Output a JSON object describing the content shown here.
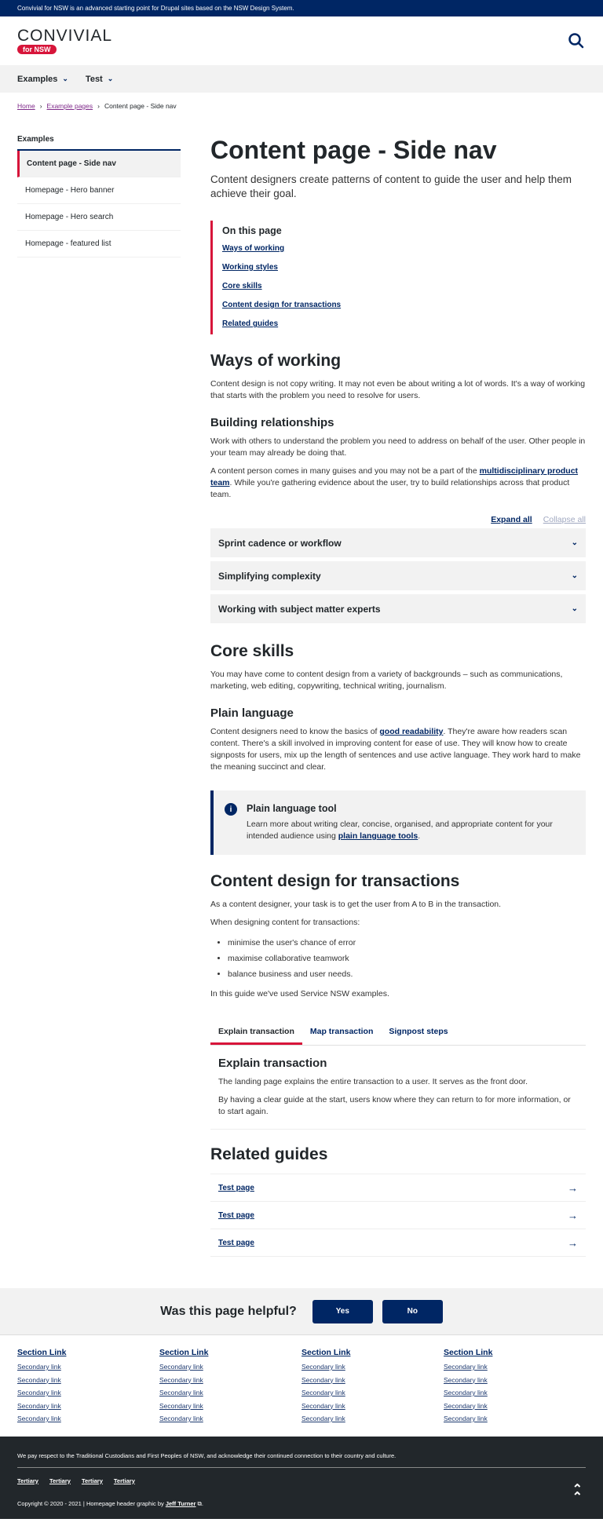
{
  "masthead": {
    "text": "Convivial for NSW is an advanced starting point for Drupal sites based on the NSW Design System."
  },
  "header": {
    "logo_word": "CONVIVIAL",
    "logo_pill": "for NSW",
    "search_icon": "search-icon"
  },
  "mainnav": {
    "items": [
      {
        "label": "Examples"
      },
      {
        "label": "Test"
      }
    ]
  },
  "breadcrumb": {
    "items": [
      {
        "label": "Home"
      },
      {
        "label": "Example pages"
      }
    ],
    "current": "Content page - Side nav"
  },
  "sidenav": {
    "title": "Examples",
    "items": [
      {
        "label": "Content page - Side nav",
        "active": true
      },
      {
        "label": "Homepage - Hero banner"
      },
      {
        "label": "Homepage - Hero search"
      },
      {
        "label": "Homepage - featured list"
      }
    ]
  },
  "page": {
    "title": "Content page - Side nav",
    "intro": "Content designers create patterns of content to guide the user and help them achieve their goal."
  },
  "on_this_page": {
    "title": "On this page",
    "links": [
      "Ways of working",
      "Working styles",
      "Core skills",
      "Content design for transactions",
      "Related guides"
    ]
  },
  "ways": {
    "title": "Ways of working",
    "p1": "Content design is not copy writing. It may not even be about writing a lot of words. It's a way of working that starts with the problem you need to resolve for users.",
    "sub": "Building relationships",
    "p2": "Work with others to understand the problem you need to address on behalf of the user. Other people in your team may already be doing that.",
    "p3_before": "A content person comes in many guises and you may not be a part of the ",
    "p3_link": "multidisciplinary product team",
    "p3_after": ". While you're gathering evidence about the user, try to build relationships across that product team."
  },
  "accordion": {
    "expand_all": "Expand all",
    "collapse_all": "Collapse all",
    "items": [
      "Sprint cadence or workflow",
      "Simplifying complexity",
      "Working with subject matter experts"
    ]
  },
  "core": {
    "title": "Core skills",
    "p1": "You may have come to content design from a variety of backgrounds – such as communications, marketing, web editing, copywriting, technical writing, journalism.",
    "sub": "Plain language",
    "p2_before": "Content designers need to know the basics of ",
    "p2_link": "good readability",
    "p2_after": ". They're aware how readers scan content. There's a skill involved in improving content for ease of use. They will know how to create signposts for users, mix up the length of sentences and use active language. They work hard to make the meaning succinct and clear."
  },
  "callout": {
    "title": "Plain language tool",
    "text_before": "Learn more about writing clear, concise, organised, and appropriate content for your intended audience using ",
    "link": "plain language tools",
    "text_after": "."
  },
  "transactions": {
    "title": "Content design for transactions",
    "p1": "As a content designer, your task is to get the user from A to B in the transaction.",
    "p2": "When designing content for transactions:",
    "bullets": [
      "minimise the user's chance of error",
      "maximise collaborative teamwork",
      "balance business and user needs."
    ],
    "p3": "In this guide we've used Service NSW examples."
  },
  "tabs": {
    "items": [
      {
        "label": "Explain transaction",
        "active": true
      },
      {
        "label": "Map transaction"
      },
      {
        "label": "Signpost steps"
      }
    ],
    "panel_title": "Explain transaction",
    "panel_p1": "The landing page explains the entire transaction to a user. It serves as the front door.",
    "panel_p2": "By having a clear guide at the start, users know where they can return to for more information, or to start again."
  },
  "related": {
    "title": "Related guides",
    "items": [
      "Test page",
      "Test page",
      "Test page"
    ]
  },
  "feedback": {
    "question": "Was this page helpful?",
    "yes": "Yes",
    "no": "No"
  },
  "footer": {
    "columns": [
      {
        "section": "Section Link",
        "links": [
          "Secondary link",
          "Secondary link",
          "Secondary link",
          "Secondary link",
          "Secondary link"
        ]
      },
      {
        "section": "Section Link",
        "links": [
          "Secondary link",
          "Secondary link",
          "Secondary link",
          "Secondary link",
          "Secondary link"
        ]
      },
      {
        "section": "Section Link",
        "links": [
          "Secondary link",
          "Secondary link",
          "Secondary link",
          "Secondary link",
          "Secondary link"
        ]
      },
      {
        "section": "Section Link",
        "links": [
          "Secondary link",
          "Secondary link",
          "Secondary link",
          "Secondary link",
          "Secondary link"
        ]
      }
    ],
    "acknowledgement": "We pay respect to the Traditional Custodians and First Peoples of NSW, and acknowledge their continued connection to their country and culture.",
    "tertiary": [
      "Tertiary",
      "Tertiary",
      "Tertiary",
      "Tertiary"
    ],
    "copyright_before": "Copyright © 2020 - 2021 | Homepage header graphic by ",
    "copyright_link": "Jeff Turner",
    "copyright_after": "."
  },
  "colors": {
    "primary": "#002664",
    "accent": "#d7153a",
    "grey_bg": "#f2f2f2",
    "footer_bg": "#22272b"
  }
}
